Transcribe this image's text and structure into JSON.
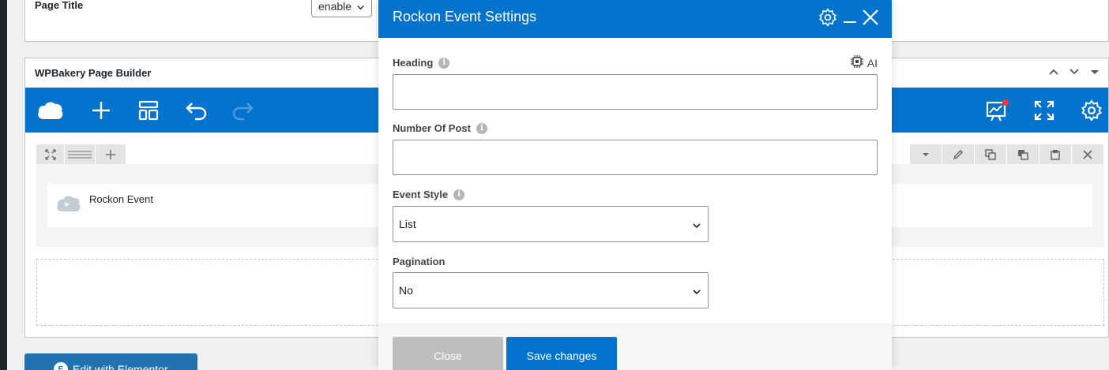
{
  "page_title_box": {
    "label": "Page Title",
    "select_value": "enable"
  },
  "wpbakery": {
    "title": "WPBakery Page Builder",
    "element_name": "Rockon Event",
    "toolbar_color": "#0473ce"
  },
  "elementor_button": {
    "label": "Edit with Elementor"
  },
  "modal": {
    "title": "Rockon Event Settings",
    "ai_label": "AI",
    "fields": {
      "heading": {
        "label": "Heading",
        "value": ""
      },
      "number_of_post": {
        "label": "Number Of Post",
        "value": ""
      },
      "event_style": {
        "label": "Event Style",
        "value": "List"
      },
      "pagination": {
        "label": "Pagination",
        "value": "No"
      }
    },
    "buttons": {
      "close": "Close",
      "save": "Save changes"
    }
  },
  "icons": {
    "toolbar": [
      "cloud-logo-icon",
      "add-icon",
      "layout-icon",
      "undo-icon",
      "redo-icon",
      "frontend-editor-icon",
      "fullscreen-icon",
      "settings-icon"
    ],
    "modal_header": [
      "gear-icon",
      "minimize-icon",
      "close-icon"
    ]
  }
}
